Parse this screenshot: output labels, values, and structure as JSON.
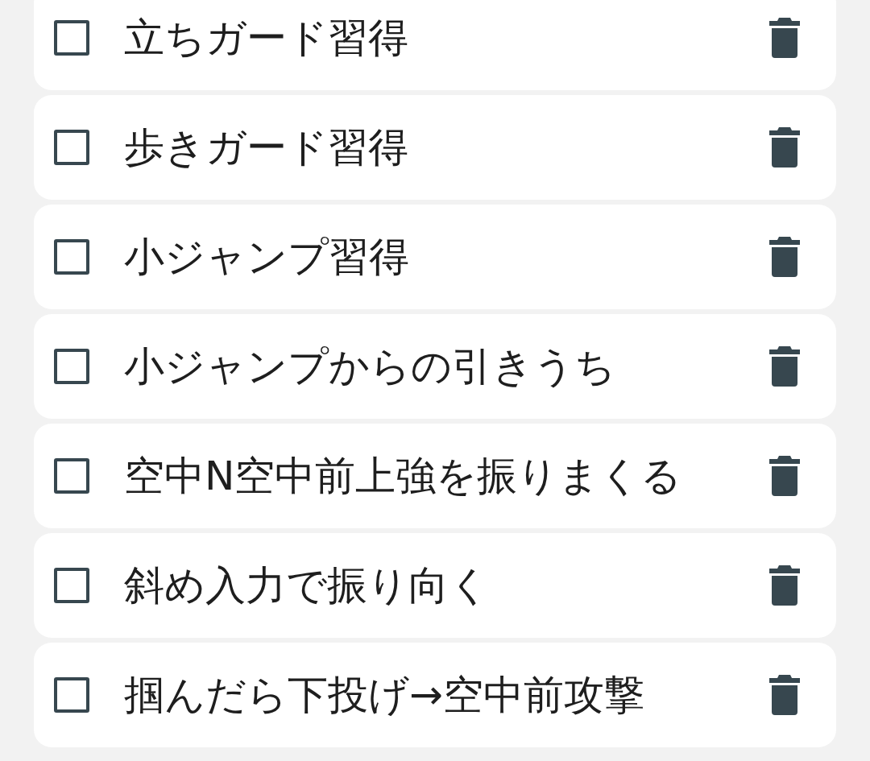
{
  "tasks": [
    {
      "label": "立ちガード習得",
      "checked": false
    },
    {
      "label": "歩きガード習得",
      "checked": false
    },
    {
      "label": "小ジャンプ習得",
      "checked": false
    },
    {
      "label": "小ジャンプからの引きうち",
      "checked": false
    },
    {
      "label": "空中N空中前上強を振りまくる",
      "checked": false
    },
    {
      "label": "斜め入力で振り向く",
      "checked": false
    },
    {
      "label": "掴んだら下投げ→空中前攻撃",
      "checked": false
    }
  ]
}
